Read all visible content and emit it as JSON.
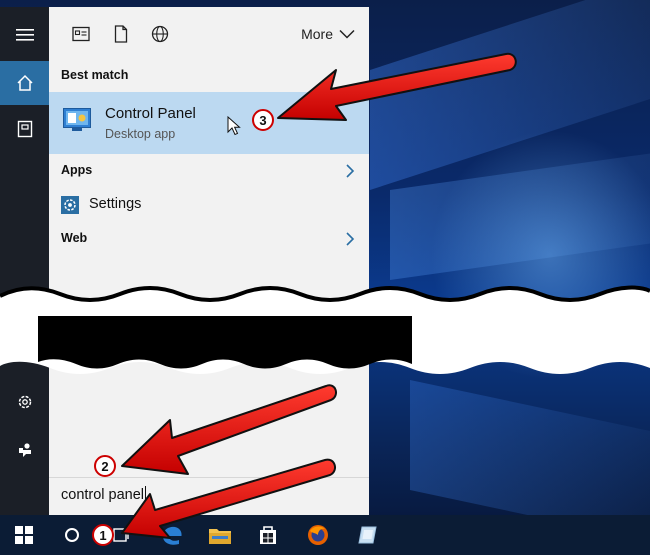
{
  "start_menu": {
    "top_bar": {
      "more_label": "More"
    },
    "best_match": {
      "section_label": "Best match",
      "item": {
        "title": "Control Panel",
        "subtitle": "Desktop app"
      }
    },
    "apps": {
      "section_label": "Apps",
      "items": [
        {
          "label": "Settings",
          "icon": "gear-icon"
        }
      ]
    },
    "web": {
      "section_label": "Web"
    },
    "search": {
      "value": "control panel"
    }
  },
  "left_rail": {
    "items": [
      {
        "icon": "hamburger-icon"
      },
      {
        "icon": "home-icon",
        "active": true
      },
      {
        "icon": "notebook-icon"
      },
      {
        "icon": "gear-icon"
      },
      {
        "icon": "feedback-icon"
      }
    ]
  },
  "taskbar": {
    "items": [
      {
        "icon": "windows-logo-icon"
      },
      {
        "icon": "cortana-circle-icon"
      },
      {
        "icon": "task-view-icon"
      },
      {
        "icon": "edge-icon"
      },
      {
        "icon": "file-explorer-icon"
      },
      {
        "icon": "store-icon"
      },
      {
        "icon": "firefox-icon"
      },
      {
        "icon": "app-icon"
      }
    ]
  },
  "callouts": [
    {
      "number": "1"
    },
    {
      "number": "2"
    },
    {
      "number": "3"
    }
  ],
  "colors": {
    "highlight": "#bcd9f1",
    "rail_active": "#2a6ea3",
    "arrow_red": "#e00000",
    "panel_bg": "#f2f2f2",
    "taskbar_bg": "#0b1c35"
  }
}
